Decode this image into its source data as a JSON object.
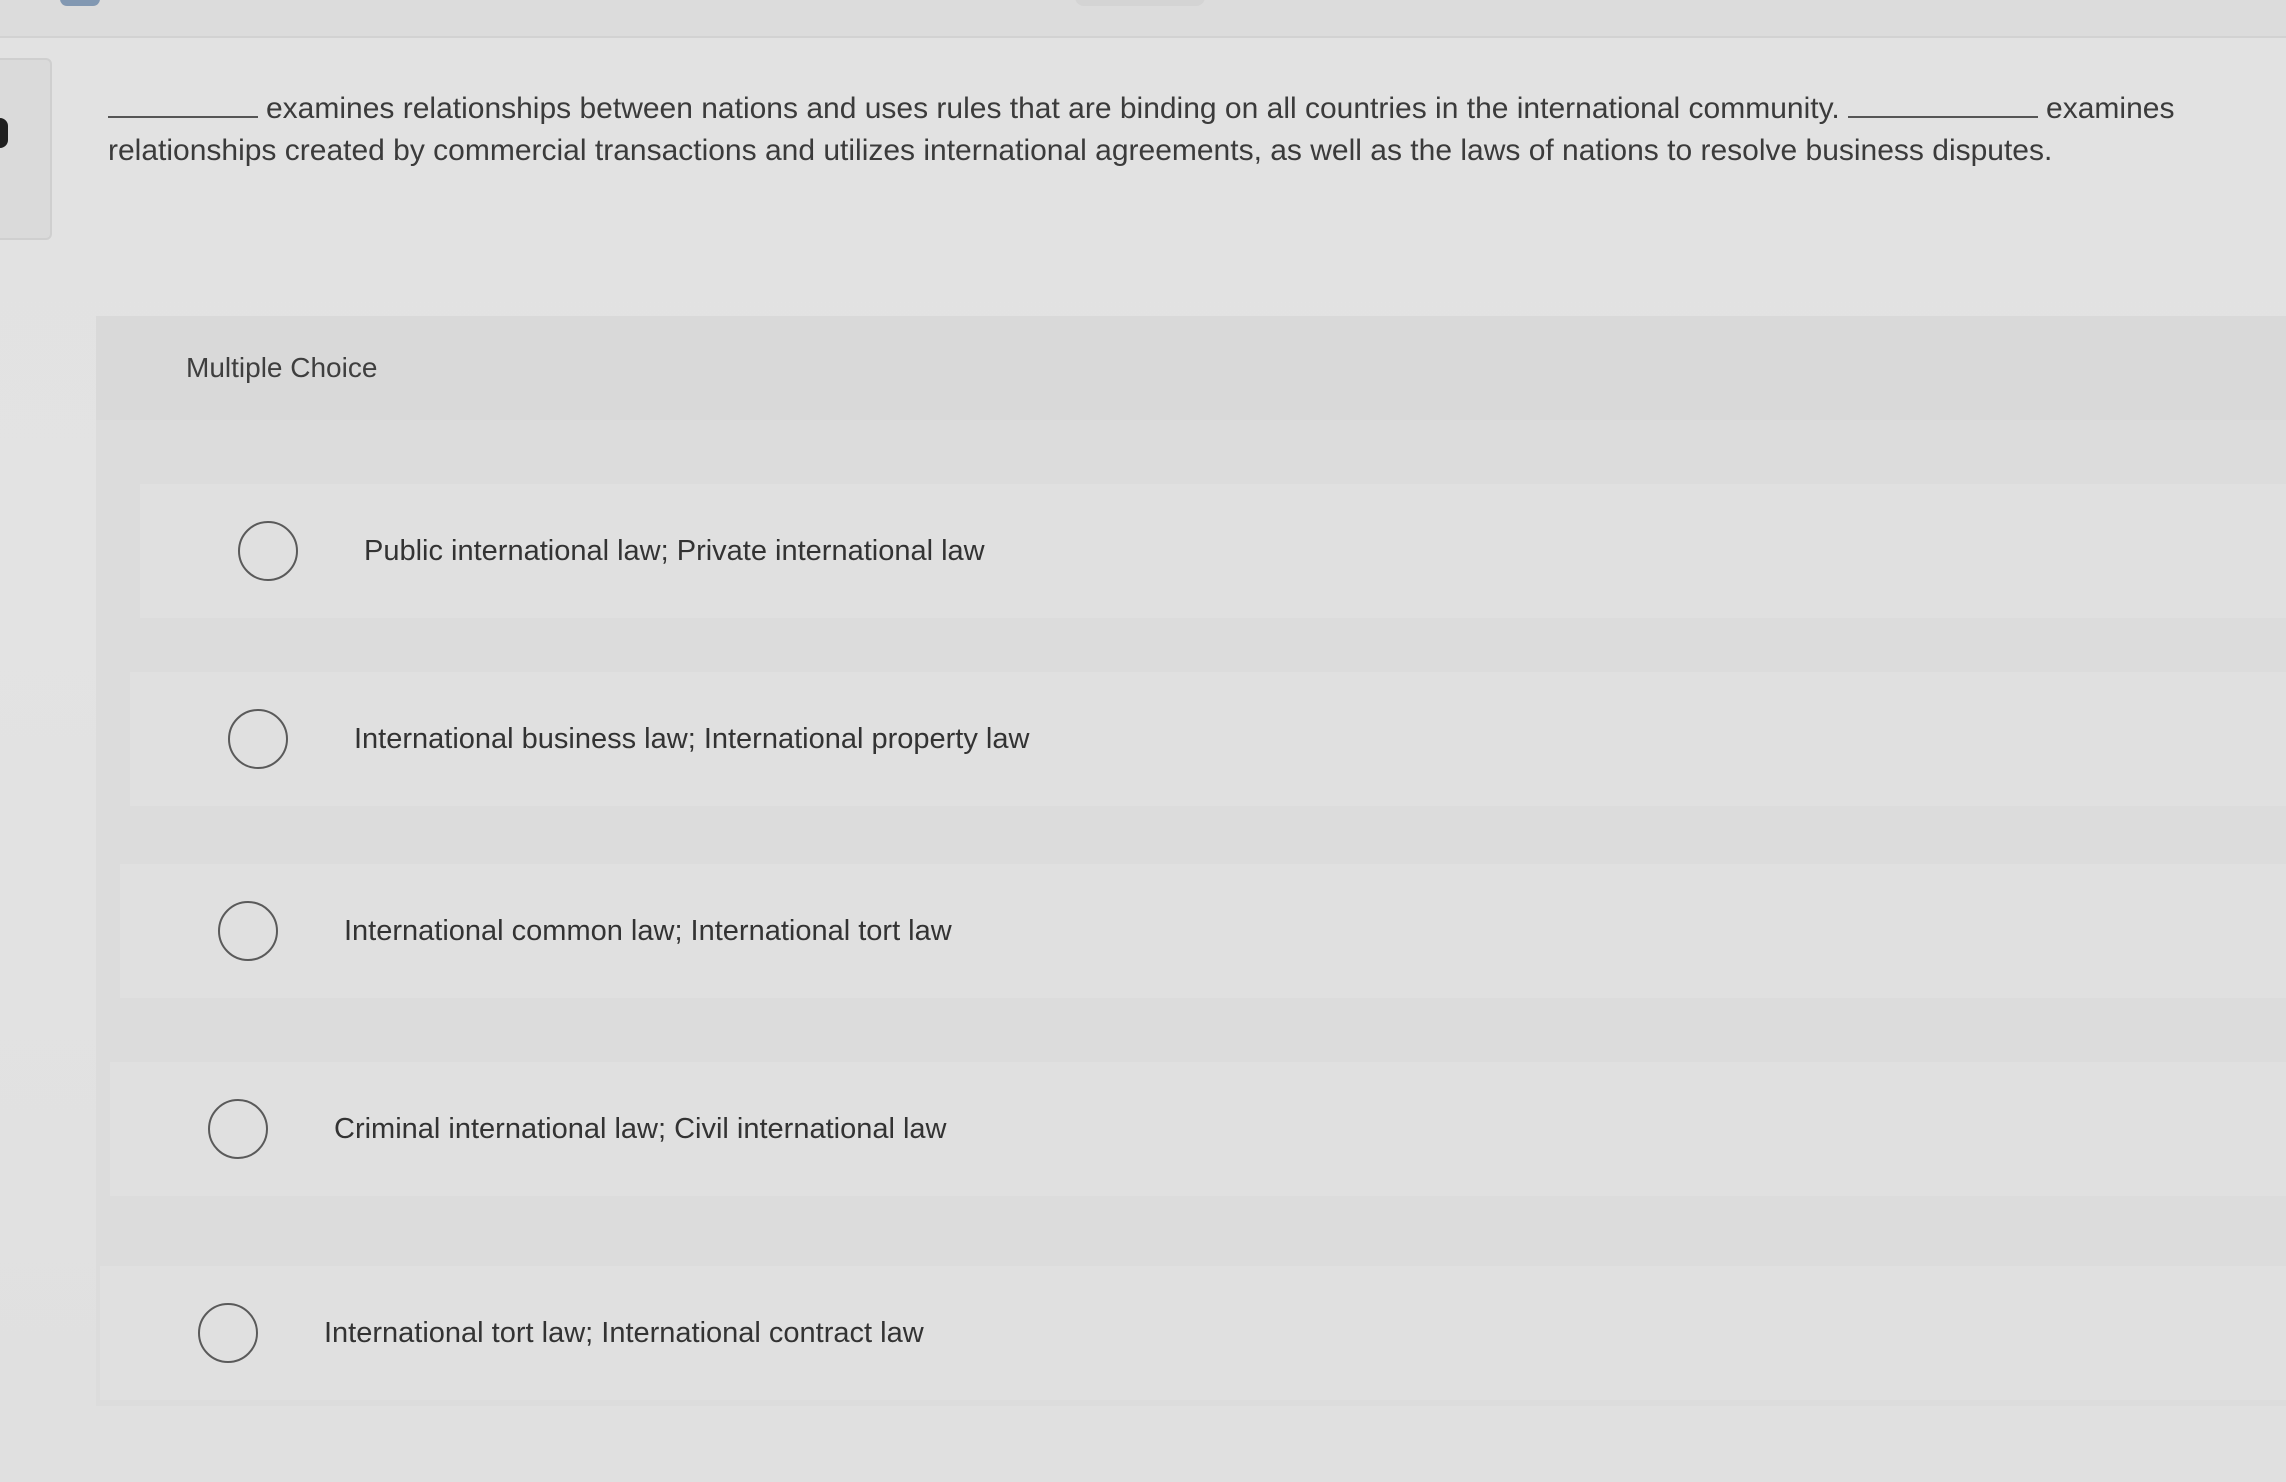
{
  "question": {
    "text_part1": "examines relationships between nations and uses rules that are binding on all countries in the international community.",
    "text_part2": "examines relationships created by commercial transactions and utilizes international agreements, as well as the laws of nations to resolve business disputes."
  },
  "panel": {
    "label": "Multiple Choice"
  },
  "options": [
    {
      "label": "Public international law; Private international law",
      "selected": false
    },
    {
      "label": "International business law; International property law",
      "selected": false
    },
    {
      "label": "International common law; International tort law",
      "selected": false
    },
    {
      "label": "Criminal international law; Civil international law",
      "selected": false
    },
    {
      "label": "International tort law; International contract law",
      "selected": false
    }
  ],
  "colors": {
    "background": "#e0e0e0",
    "text": "#333333",
    "radio_border": "#5a5a5a"
  }
}
